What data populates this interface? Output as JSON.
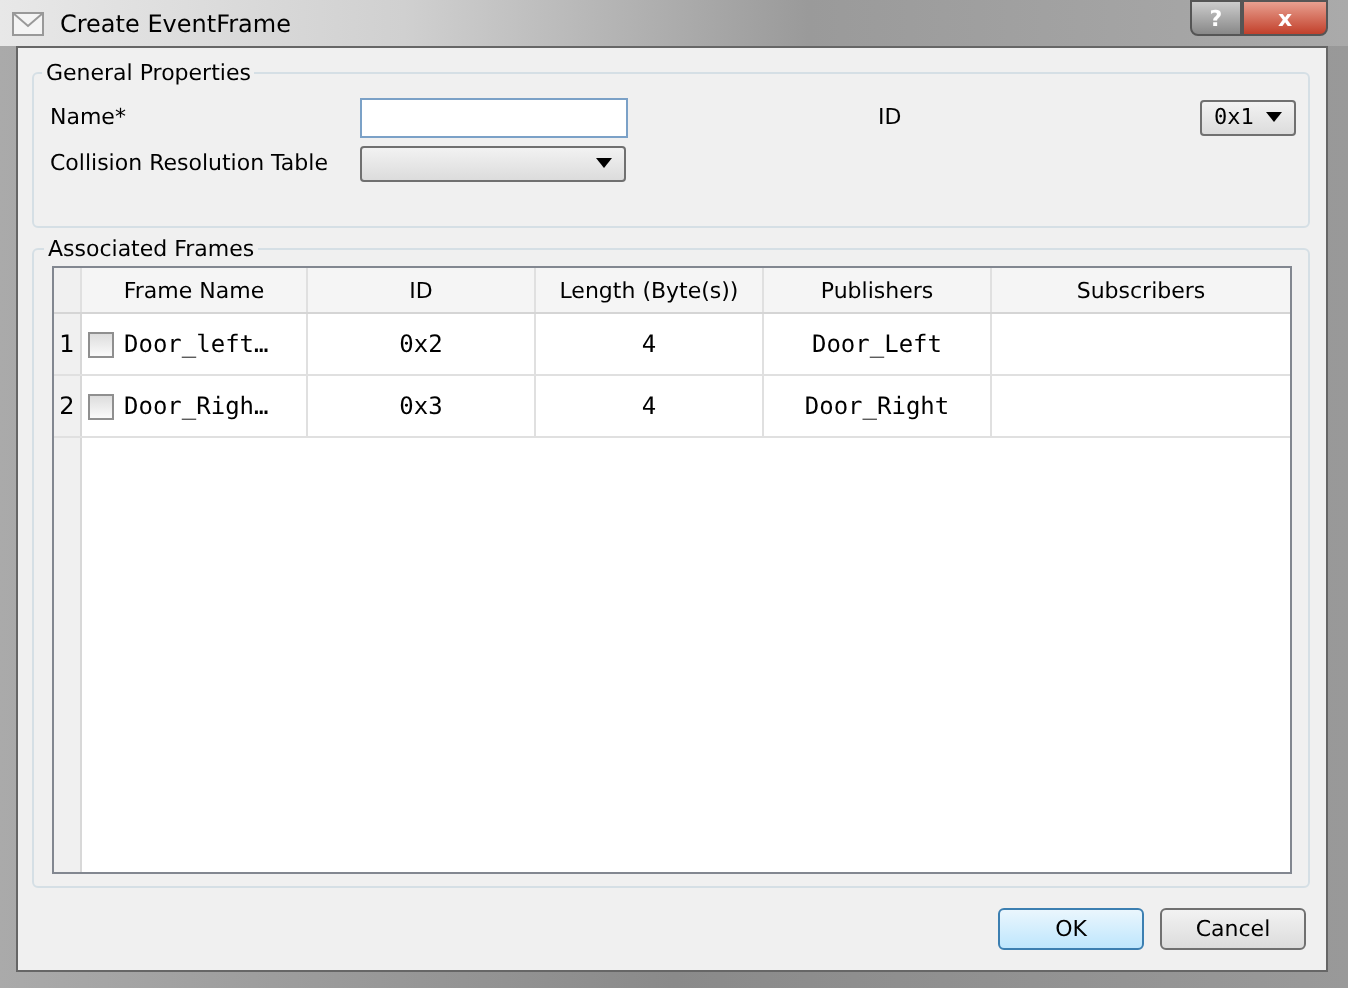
{
  "window": {
    "title": "Create EventFrame",
    "help": "?",
    "close": "x"
  },
  "general": {
    "title": "General Properties",
    "name_label": "Name*",
    "collision_label": "Collision Resolution Table",
    "id_label": "ID",
    "id_value": "0x1"
  },
  "frames": {
    "title": "Associated Frames",
    "columns": [
      "Frame Name",
      "ID",
      "Length (Byte(s))",
      "Publishers",
      "Subscribers"
    ],
    "rows": [
      {
        "index": "1",
        "checked": false,
        "cells": [
          "Door_left…",
          "0x2",
          "4",
          "Door_Left"
        ]
      },
      {
        "index": "2",
        "checked": false,
        "cells": [
          "Door_Righ…",
          "0x3",
          "4",
          "Door_Right"
        ]
      }
    ]
  },
  "buttons": [
    {
      "label": "OK",
      "default": true
    },
    {
      "label": "Cancel",
      "default": false
    }
  ]
}
